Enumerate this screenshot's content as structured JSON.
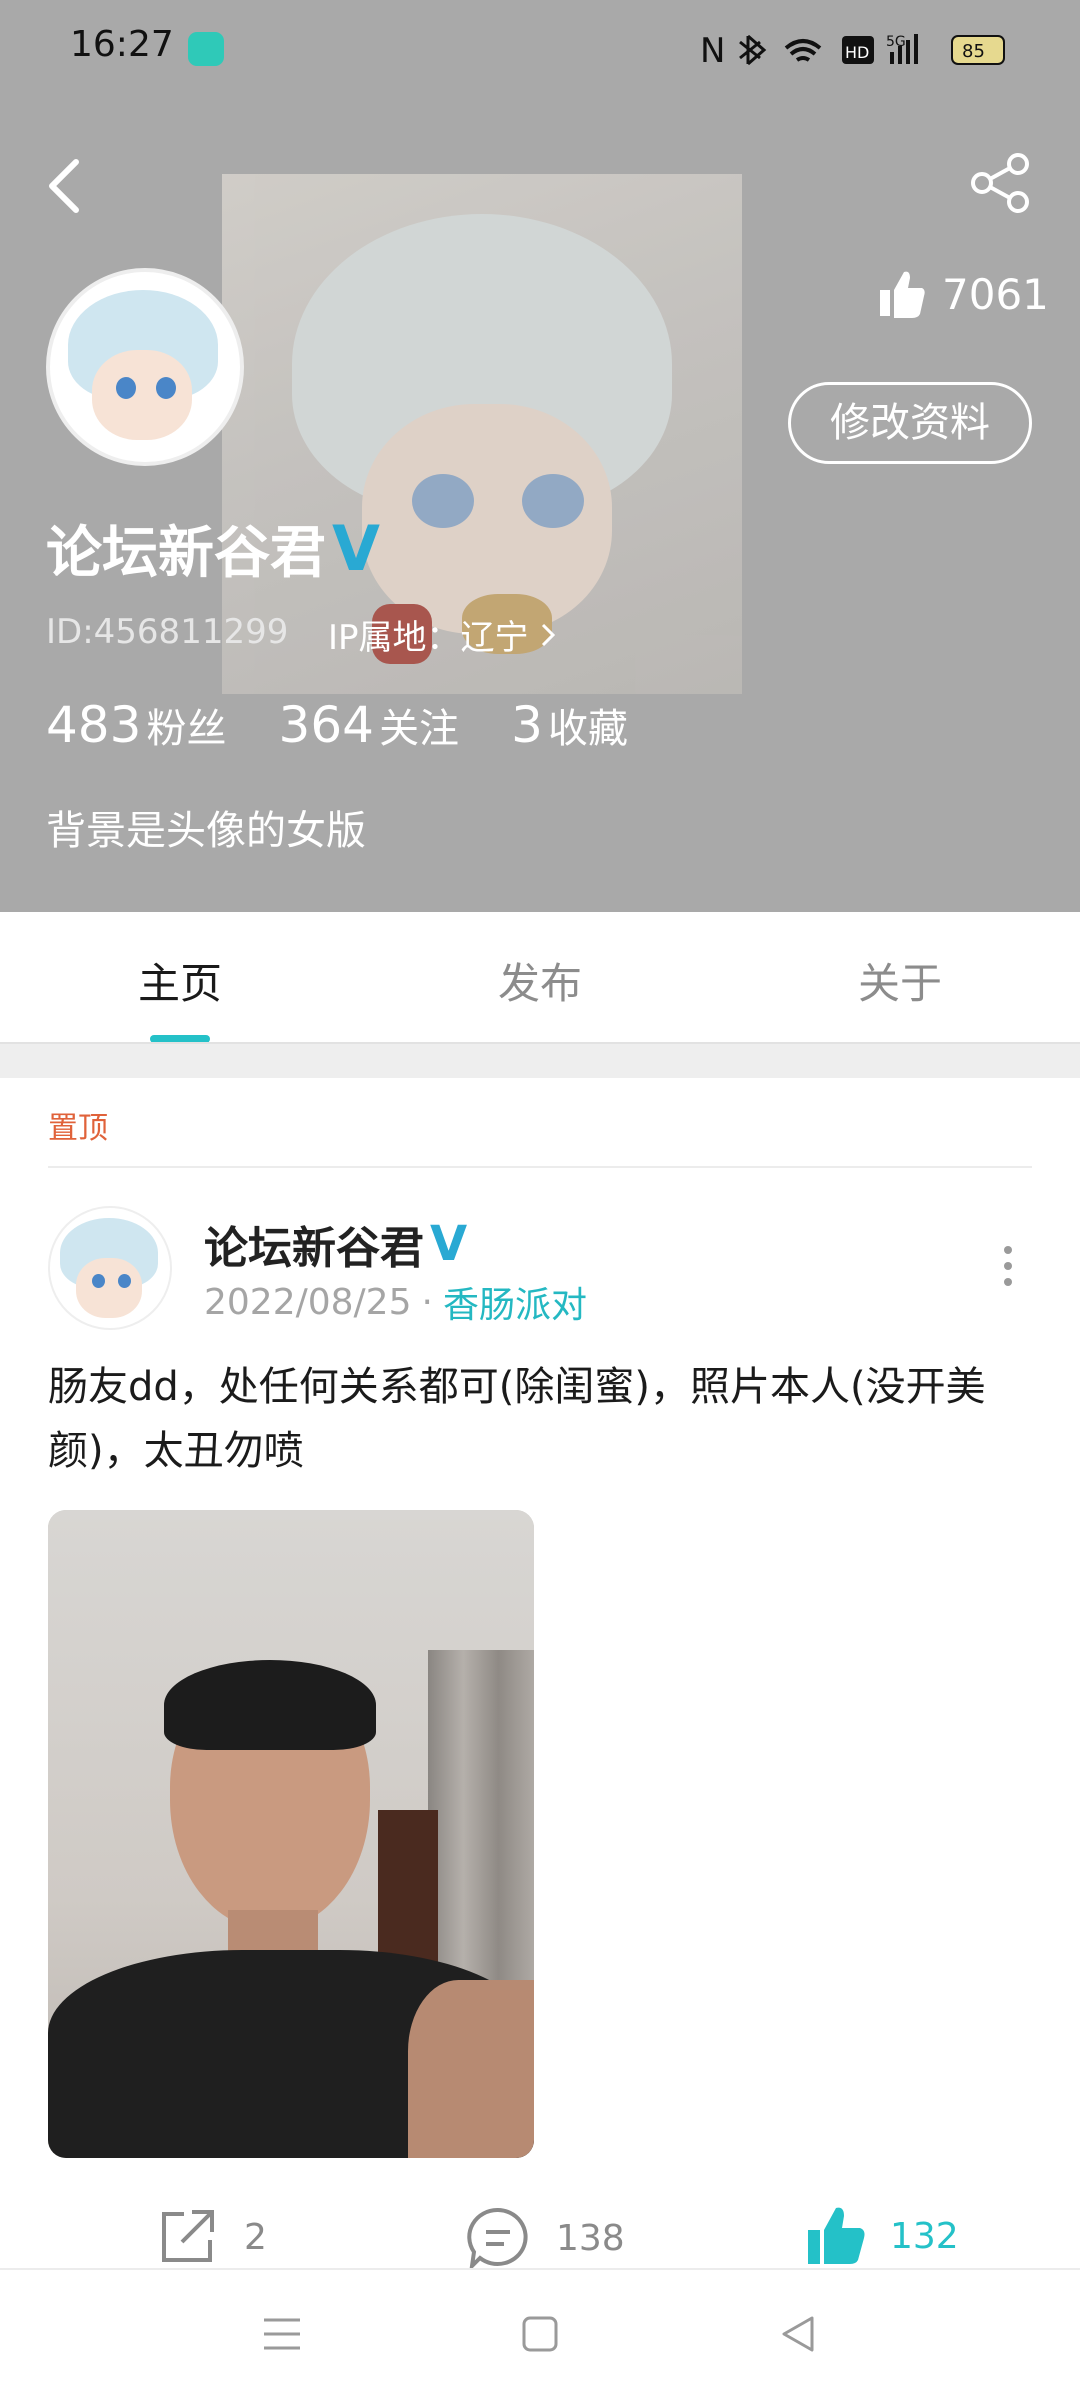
{
  "status_bar": {
    "time": "16:27",
    "battery": "85",
    "network": "5G",
    "hd": "HD"
  },
  "profile": {
    "like_count": "7061",
    "edit_button": "修改资料",
    "username": "论坛新谷君",
    "verified_mark": "V",
    "id": "ID:456811299",
    "ip_location": "IP属地：辽宁",
    "followers_count": "483",
    "followers_label": "粉丝",
    "following_count": "364",
    "following_label": "关注",
    "favorites_count": "3",
    "favorites_label": "收藏",
    "bio": "背景是头像的女版"
  },
  "tabs": [
    {
      "label": "主页",
      "active": true
    },
    {
      "label": "发布",
      "active": false
    },
    {
      "label": "关于",
      "active": false
    }
  ],
  "pinned_label": "置顶",
  "post": {
    "author": "论坛新谷君",
    "verified_mark": "V",
    "date": "2022/08/25",
    "separator": "·",
    "circle": "香肠派对",
    "text": "肠友dd，处任何关系都可(除闺蜜)，照片本人(没开美颜)，太丑勿喷",
    "share_count": "2",
    "comment_count": "138",
    "like_count": "132"
  },
  "colors": {
    "accent": "#24c1c8",
    "header_bg": "#a9a9a9",
    "pinned": "#e0623a",
    "verified": "#29a9d3"
  }
}
